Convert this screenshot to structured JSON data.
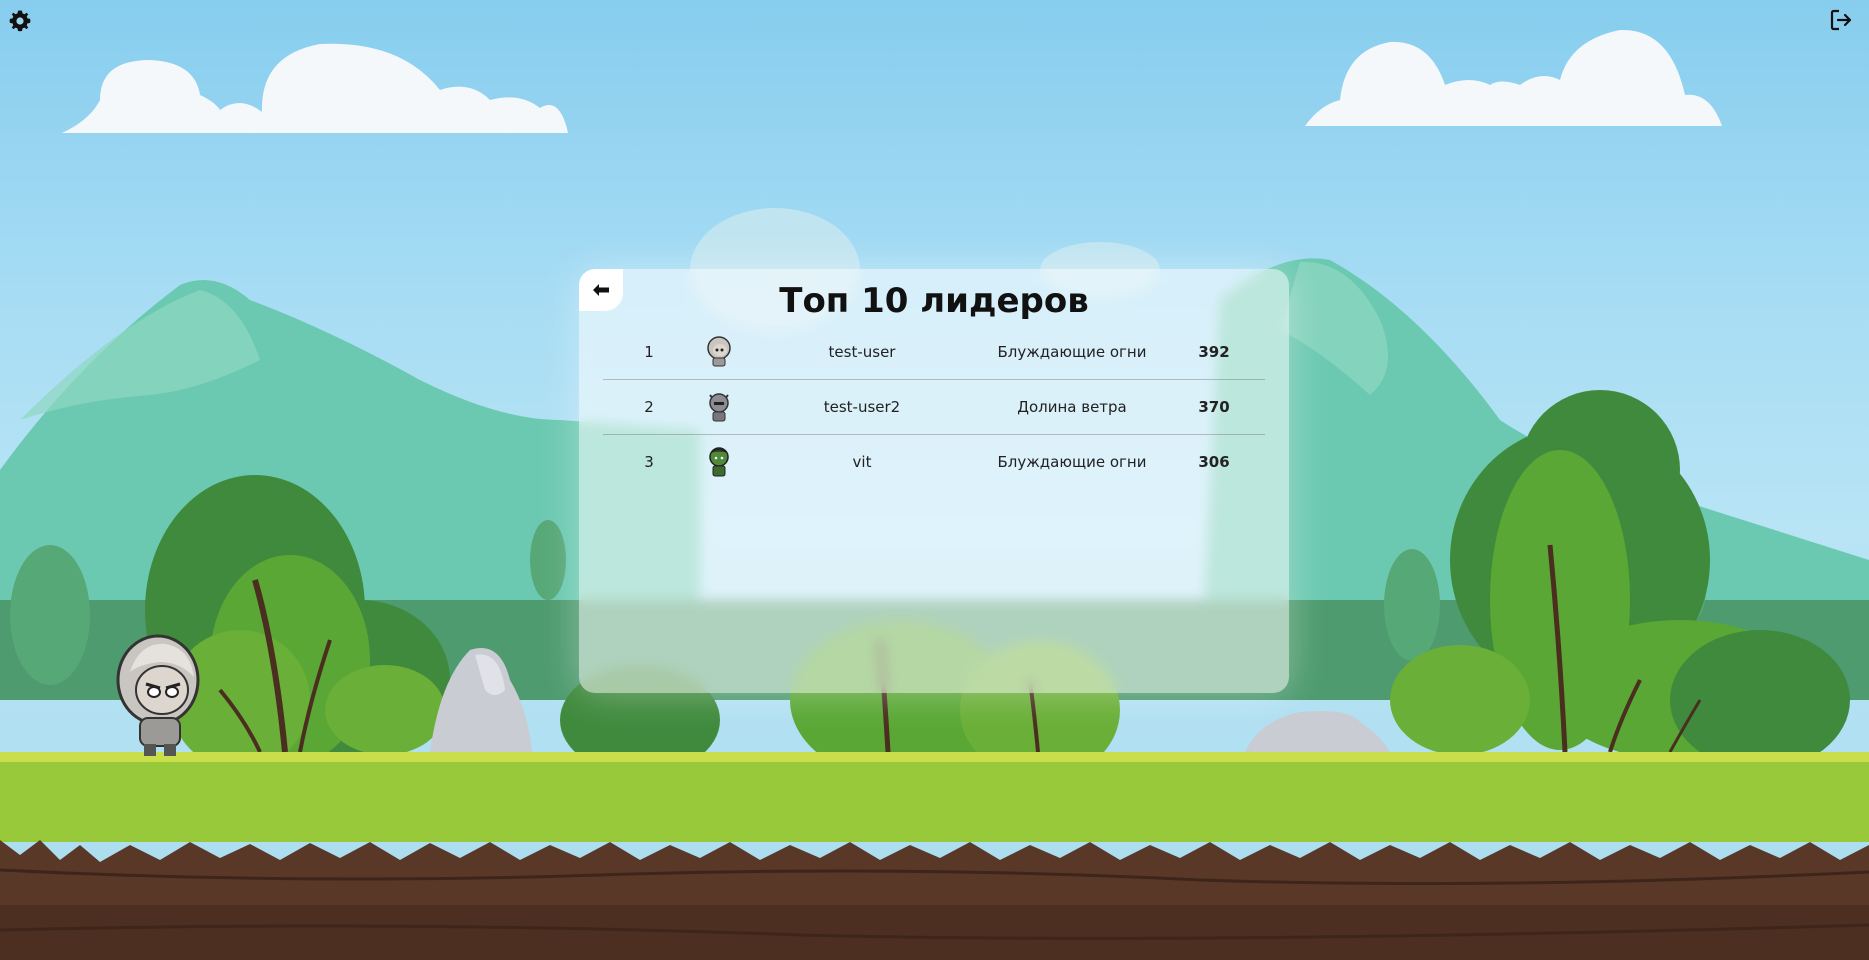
{
  "toolbar": {
    "settings_icon": "gear-icon",
    "logout_icon": "logout-icon"
  },
  "leaderboard": {
    "back_icon": "arrow-left-icon",
    "title": "Топ 10 лидеров",
    "rows": [
      {
        "rank": "1",
        "avatar": "white-haired-girl-avatar",
        "username": "test-user",
        "level": "Блуждающие огни",
        "score": "392"
      },
      {
        "rank": "2",
        "avatar": "horned-knight-avatar",
        "username": "test-user2",
        "level": "Долина ветра",
        "score": "370"
      },
      {
        "rank": "3",
        "avatar": "green-orc-avatar",
        "username": "vit",
        "level": "Блуждающие огни",
        "score": "306"
      }
    ]
  },
  "colors": {
    "sky": "#87cdee",
    "grass": "#97c93b",
    "soil": "#5a3828"
  }
}
